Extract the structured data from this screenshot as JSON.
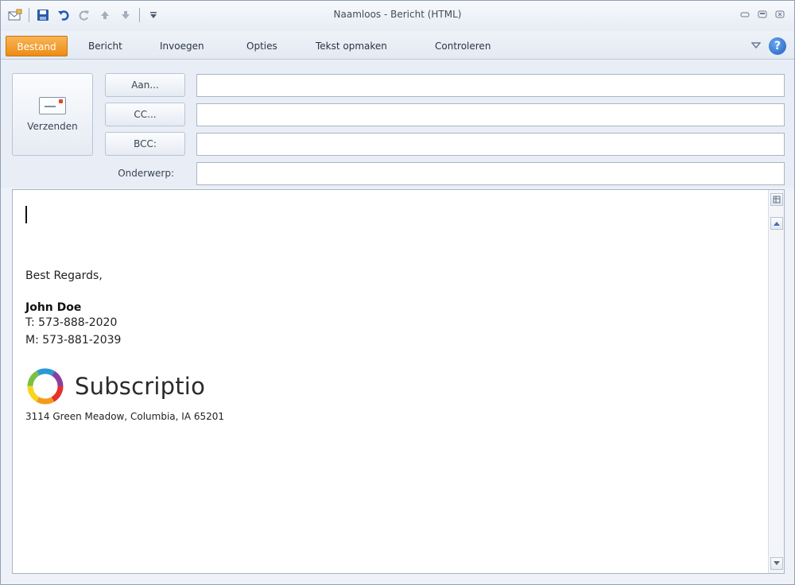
{
  "window": {
    "title": "Naamloos - Bericht (HTML)"
  },
  "ribbon": {
    "tabs": [
      {
        "label": "Bestand"
      },
      {
        "label": "Bericht"
      },
      {
        "label": "Invoegen"
      },
      {
        "label": "Opties"
      },
      {
        "label": "Tekst opmaken"
      },
      {
        "label": "Controleren"
      }
    ],
    "help": "?"
  },
  "header": {
    "send_label": "Verzenden",
    "to_label": "Aan...",
    "cc_label": "CC...",
    "bcc_label": "BCC:",
    "subject_label": "Onderwerp:",
    "to_value": "",
    "cc_value": "",
    "bcc_value": "",
    "subject_value": ""
  },
  "message": {
    "greeting": "Best Regards,",
    "name": "John Doe",
    "phone": "T: 573-888-2020",
    "mobile": "M: 573-881-2039",
    "company": "Subscriptio",
    "address": "3114 Green Meadow, Columbia, IA 65201"
  },
  "icons": {
    "qat": [
      "mail-icon",
      "save-icon",
      "undo-icon",
      "redo-icon",
      "up-arrow-icon",
      "down-arrow-icon",
      "customize-qat-icon"
    ],
    "window_controls": [
      "minimize-icon",
      "restore-icon",
      "close-icon"
    ]
  }
}
